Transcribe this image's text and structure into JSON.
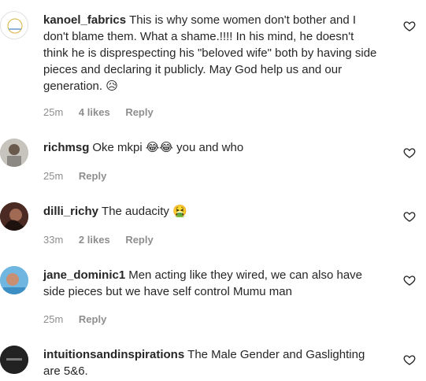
{
  "comments": [
    {
      "username": "kanoel_fabrics",
      "text": "This is why some women don't bother and I don't blame them. What a shame.!!!! In his mind, he doesn't think he is disprespecting his \"beloved wife\" both by having side pieces and declaring it publicly. May God help us and our generation.",
      "emoji": "😥",
      "time": "25m",
      "likes": "4 likes",
      "reply": "Reply"
    },
    {
      "username": "richmsg",
      "text": "Oke mkpi",
      "emoji": "😂😂",
      "text_after": "you and who",
      "time": "25m",
      "reply": "Reply"
    },
    {
      "username": "dilli_richy",
      "text": "The audacity",
      "emoji": "🤮",
      "time": "33m",
      "likes": "2 likes",
      "reply": "Reply"
    },
    {
      "username": "jane_dominic1",
      "text": "Men acting like they wired, we can also have side pieces but we have self control Mumu man",
      "time": "25m",
      "reply": "Reply"
    },
    {
      "username": "intuitionsandinspirations",
      "text": "The Male Gender and Gaslighting are 5&6."
    }
  ],
  "icons": {
    "like": "heart-outline-icon"
  }
}
